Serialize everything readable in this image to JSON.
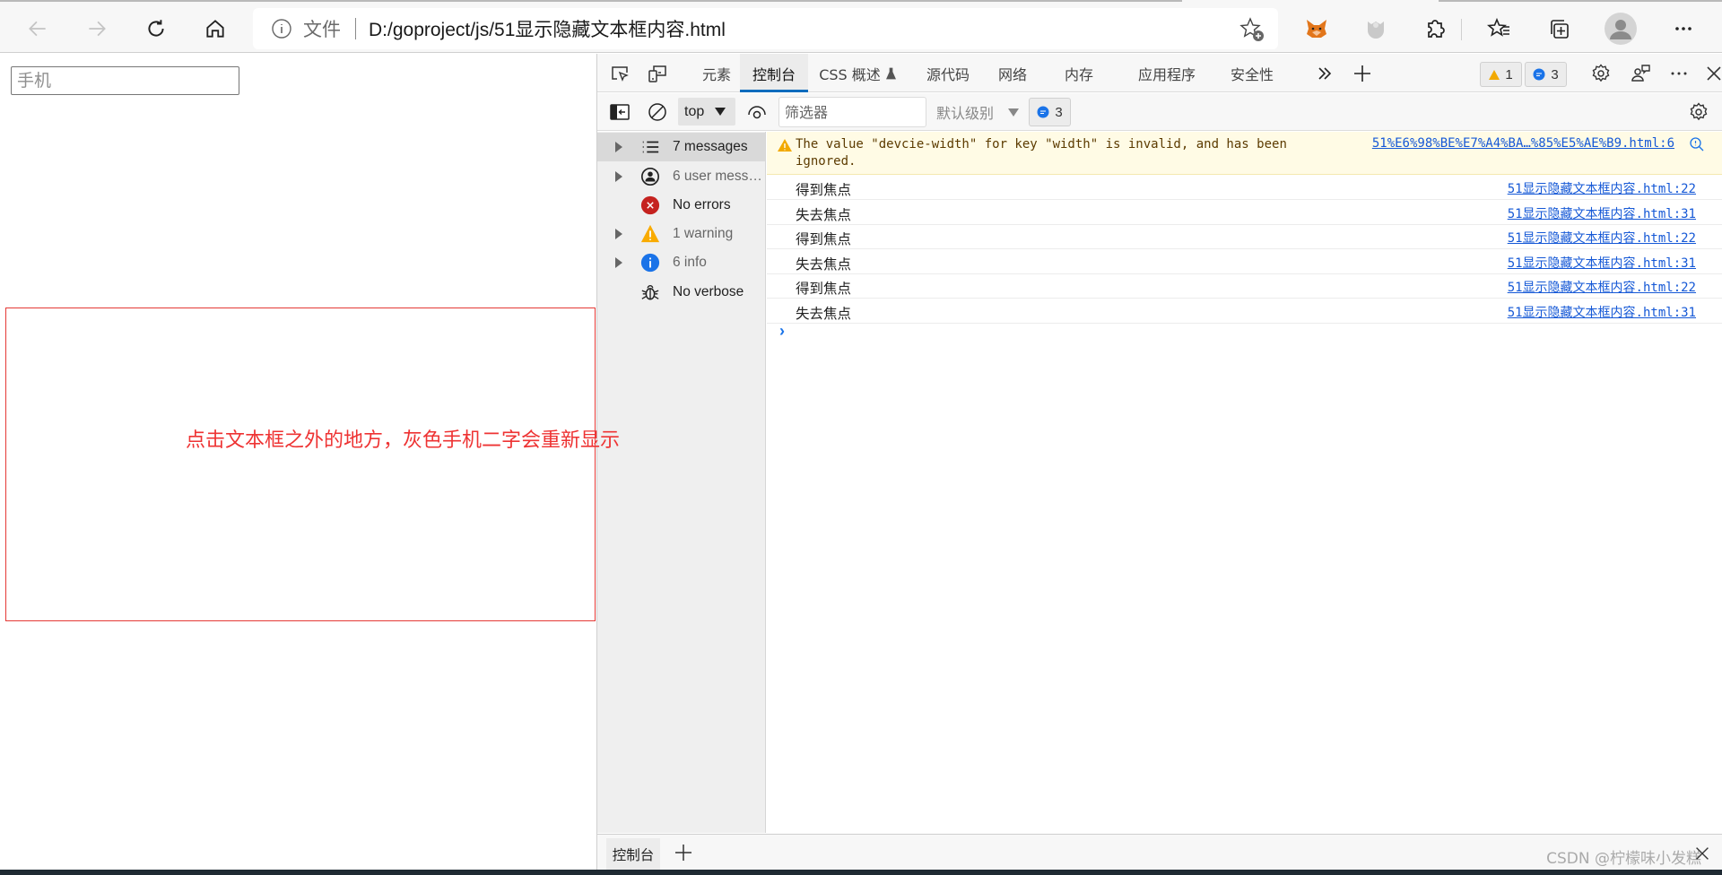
{
  "browser": {
    "address_bar": {
      "security_label": "文件",
      "url": "D:/goproject/js/51显示隐藏文本框内容.html"
    },
    "extensions": [
      "metamask-fox",
      "grey-extension"
    ],
    "icons": {
      "back": "arrow-left-icon",
      "forward": "arrow-right-icon",
      "refresh": "refresh-icon",
      "home": "home-icon",
      "add_favorite": "star-add-icon",
      "extensions": "puzzle-icon",
      "favorites": "star-list-icon",
      "collections": "collections-icon",
      "profile": "avatar-icon",
      "more": "ellipsis-icon"
    }
  },
  "page": {
    "phone_input": {
      "value": "",
      "placeholder": "手机"
    },
    "hint_text": "点击文本框之外的地方，灰色手机二字会重新显示",
    "colors": {
      "hint": "#ee3333",
      "box_border": "#e53935"
    }
  },
  "devtools": {
    "tabs": [
      {
        "label": "元素",
        "active": false
      },
      {
        "label": "控制台",
        "active": true
      },
      {
        "label": "CSS 概述",
        "active": false,
        "experimental": true
      },
      {
        "label": "源代码",
        "active": false
      },
      {
        "label": "网络",
        "active": false
      },
      {
        "label": "内存",
        "active": false
      },
      {
        "label": "应用程序",
        "active": false
      },
      {
        "label": "安全性",
        "active": false
      }
    ],
    "issue_badges": {
      "warnings": "1",
      "messages": "3"
    },
    "toolbar": {
      "context": "top",
      "filter": {
        "value": "",
        "placeholder": "筛选器"
      },
      "level": "默认级别",
      "message_count": "3"
    },
    "sidebar": [
      {
        "label": "7 messages",
        "expandable": true,
        "icon": "list-icon",
        "selected": true
      },
      {
        "label": "6 user messa...",
        "expandable": true,
        "icon": "user-icon",
        "selected": false
      },
      {
        "label": "No errors",
        "expandable": false,
        "icon": "error-icon",
        "selected": false
      },
      {
        "label": "1 warning",
        "expandable": true,
        "icon": "warning-icon",
        "selected": false
      },
      {
        "label": "6 info",
        "expandable": true,
        "icon": "info-icon",
        "selected": false
      },
      {
        "label": "No verbose",
        "expandable": false,
        "icon": "bug-icon",
        "selected": false
      }
    ],
    "warning": {
      "text": "The value \"devcie-width\" for key \"width\" is invalid, and has been ignored.",
      "source": "51%E6%98%BE%E7%A4%BA…%85%E5%AE%B9.html:6"
    },
    "logs": [
      {
        "text": "得到焦点",
        "source": "51显示隐藏文本框内容.html:22"
      },
      {
        "text": "失去焦点",
        "source": "51显示隐藏文本框内容.html:31"
      },
      {
        "text": "得到焦点",
        "source": "51显示隐藏文本框内容.html:22"
      },
      {
        "text": "失去焦点",
        "source": "51显示隐藏文本框内容.html:31"
      },
      {
        "text": "得到焦点",
        "source": "51显示隐藏文本框内容.html:22"
      },
      {
        "text": "失去焦点",
        "source": "51显示隐藏文本框内容.html:31"
      }
    ],
    "prompt": "›",
    "drawer": {
      "tab_label": "控制台"
    },
    "colors": {
      "accent": "#0f6cbd",
      "link": "#1558d6",
      "warning_bg": "#fffbe5"
    }
  },
  "watermark": "CSDN @柠檬味小发糕"
}
